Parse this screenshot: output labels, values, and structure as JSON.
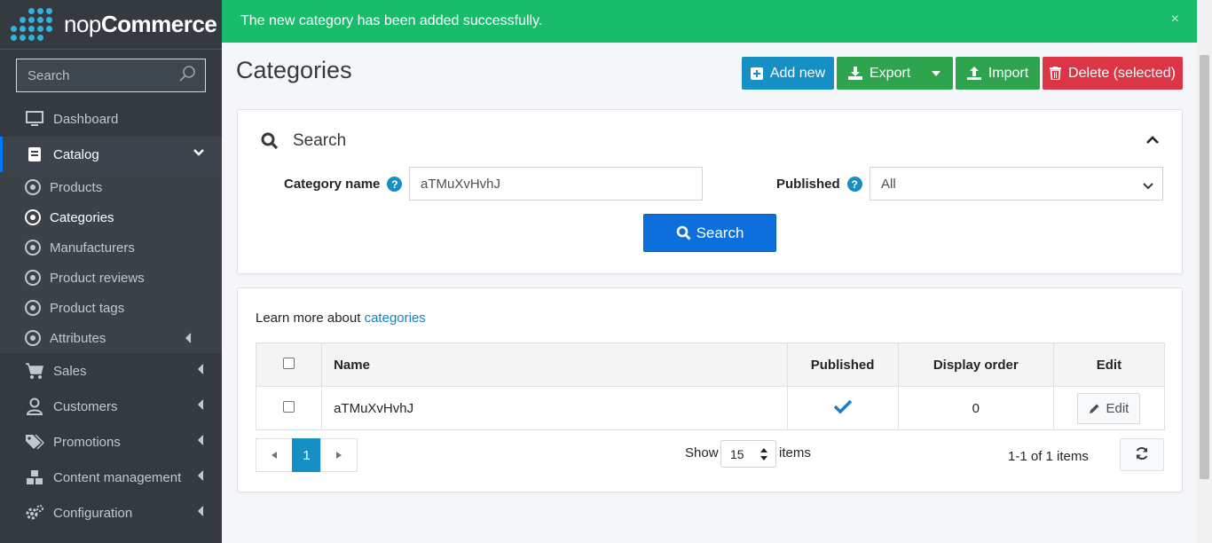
{
  "brand": {
    "light": "nop",
    "bold": "Commerce"
  },
  "sidebar": {
    "search_placeholder": "Search",
    "items": [
      {
        "label": "Dashboard",
        "icon": "monitor-icon"
      },
      {
        "label": "Catalog",
        "icon": "book-icon"
      },
      {
        "label": "Sales",
        "icon": "cart-icon"
      },
      {
        "label": "Customers",
        "icon": "user-icon"
      },
      {
        "label": "Promotions",
        "icon": "tags-icon"
      },
      {
        "label": "Content management",
        "icon": "cubes-icon"
      },
      {
        "label": "Configuration",
        "icon": "gears-icon"
      }
    ],
    "catalog_sub": [
      {
        "label": "Products"
      },
      {
        "label": "Categories"
      },
      {
        "label": "Manufacturers"
      },
      {
        "label": "Product reviews"
      },
      {
        "label": "Product tags"
      },
      {
        "label": "Attributes"
      }
    ]
  },
  "alert": {
    "message": "The new category has been added successfully.",
    "close": "×"
  },
  "header": {
    "title": "Categories",
    "add_new": "Add new",
    "export": "Export",
    "import": "Import",
    "delete_selected": "Delete (selected)"
  },
  "search_panel": {
    "title": "Search",
    "category_name_label": "Category name",
    "category_name_value": "aTMuXvHvhJ",
    "published_label": "Published",
    "published_value": "All",
    "search_button": "Search",
    "help": "?"
  },
  "list": {
    "learn_prefix": "Learn more about",
    "learn_link": "categories",
    "columns": {
      "name": "Name",
      "published": "Published",
      "display_order": "Display order",
      "edit": "Edit"
    },
    "rows": [
      {
        "name": "aTMuXvHvhJ",
        "published": true,
        "display_order": "0",
        "edit": "Edit"
      }
    ],
    "pager": {
      "current_page": "1"
    },
    "show_label": "Show",
    "page_size": "15",
    "items_label": "items",
    "range": "1-1 of 1 items"
  },
  "colors": {
    "sidebar_bg": "#343a40",
    "alert_green": "#18bc6a",
    "primary_blue": "#1690c4",
    "success_green": "#2ea44f",
    "danger_red": "#dc3545",
    "search_blue": "#0d6fdb"
  }
}
